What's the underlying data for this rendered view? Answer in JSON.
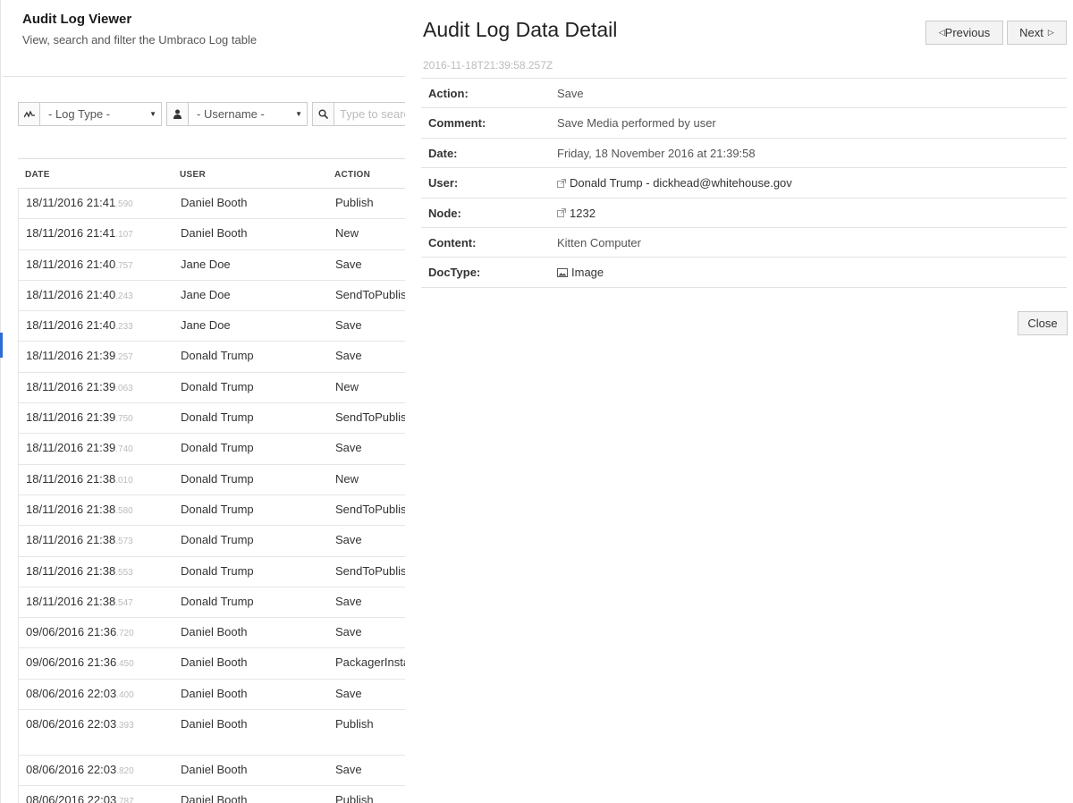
{
  "left": {
    "title": "Audit Log Viewer",
    "subtitle": "View, search and filter the Umbraco Log table",
    "filters": {
      "log_type": "- Log Type -",
      "username": "- Username -",
      "search_placeholder": "Type to search..."
    },
    "columns": {
      "date": "DATE",
      "user": "USER",
      "action": "ACTION"
    },
    "rows": [
      {
        "date": "18/11/2016 21:41",
        "ms": ".590",
        "user": "Daniel Booth",
        "action": "Publish"
      },
      {
        "date": "18/11/2016 21:41",
        "ms": ".107",
        "user": "Daniel Booth",
        "action": "New"
      },
      {
        "date": "18/11/2016 21:40",
        "ms": ".757",
        "user": "Jane Doe",
        "action": "Save"
      },
      {
        "date": "18/11/2016 21:40",
        "ms": ".243",
        "user": "Jane Doe",
        "action": "SendToPublish"
      },
      {
        "date": "18/11/2016 21:40",
        "ms": ".233",
        "user": "Jane Doe",
        "action": "Save"
      },
      {
        "date": "18/11/2016 21:39",
        "ms": ".257",
        "user": "Donald Trump",
        "action": "Save"
      },
      {
        "date": "18/11/2016 21:39",
        "ms": ".063",
        "user": "Donald Trump",
        "action": "New"
      },
      {
        "date": "18/11/2016 21:39",
        "ms": ".750",
        "user": "Donald Trump",
        "action": "SendToPublish"
      },
      {
        "date": "18/11/2016 21:39",
        "ms": ".740",
        "user": "Donald Trump",
        "action": "Save"
      },
      {
        "date": "18/11/2016 21:38",
        "ms": ".010",
        "user": "Donald Trump",
        "action": "New"
      },
      {
        "date": "18/11/2016 21:38",
        "ms": ".580",
        "user": "Donald Trump",
        "action": "SendToPublish"
      },
      {
        "date": "18/11/2016 21:38",
        "ms": ".573",
        "user": "Donald Trump",
        "action": "Save"
      },
      {
        "date": "18/11/2016 21:38",
        "ms": ".553",
        "user": "Donald Trump",
        "action": "SendToPublish"
      },
      {
        "date": "18/11/2016 21:38",
        "ms": ".547",
        "user": "Donald Trump",
        "action": "Save"
      },
      {
        "date": "09/06/2016 21:36",
        "ms": ".720",
        "user": "Daniel Booth",
        "action": "Save"
      },
      {
        "date": "09/06/2016 21:36",
        "ms": ".450",
        "user": "Daniel Booth",
        "action": "PackagerInstall"
      },
      {
        "date": "08/06/2016 22:03",
        "ms": ".400",
        "user": "Daniel Booth",
        "action": "Save"
      },
      {
        "date": "08/06/2016 22:03",
        "ms": ".393",
        "user": "Daniel Booth",
        "action": "Publish"
      },
      {
        "date": "08/06/2016 22:03",
        "ms": ".820",
        "user": "Daniel Booth",
        "action": "Save"
      },
      {
        "date": "08/06/2016 22:03",
        "ms": ".787",
        "user": "Daniel Booth",
        "action": "Publish"
      }
    ]
  },
  "detail": {
    "title": "Audit Log Data Detail",
    "timestamp": "2016-11-18T21:39:58.257Z",
    "prev_label": "Previous",
    "next_label": "Next",
    "close_label": "Close",
    "fields": {
      "action": {
        "label": "Action:",
        "value": "Save"
      },
      "comment": {
        "label": "Comment:",
        "value": "Save Media performed by user"
      },
      "date": {
        "label": "Date:",
        "value": "Friday, 18 November 2016 at 21:39:58"
      },
      "user": {
        "label": "User:",
        "value": "Donald Trump - dickhead@whitehouse.gov"
      },
      "node": {
        "label": "Node:",
        "value": "1232"
      },
      "content": {
        "label": "Content:",
        "value": "Kitten Computer"
      },
      "doctype": {
        "label": "DocType:",
        "value": "Image"
      }
    }
  },
  "icons": {
    "log_type": "activity-icon",
    "username": "user-icon",
    "search": "search-icon",
    "link": "external-link-icon",
    "doctype": "image-icon"
  },
  "colors": {
    "accent": "#2f6bd6",
    "muted_text": "#bbbbbb",
    "border": "#e2e2e2"
  }
}
